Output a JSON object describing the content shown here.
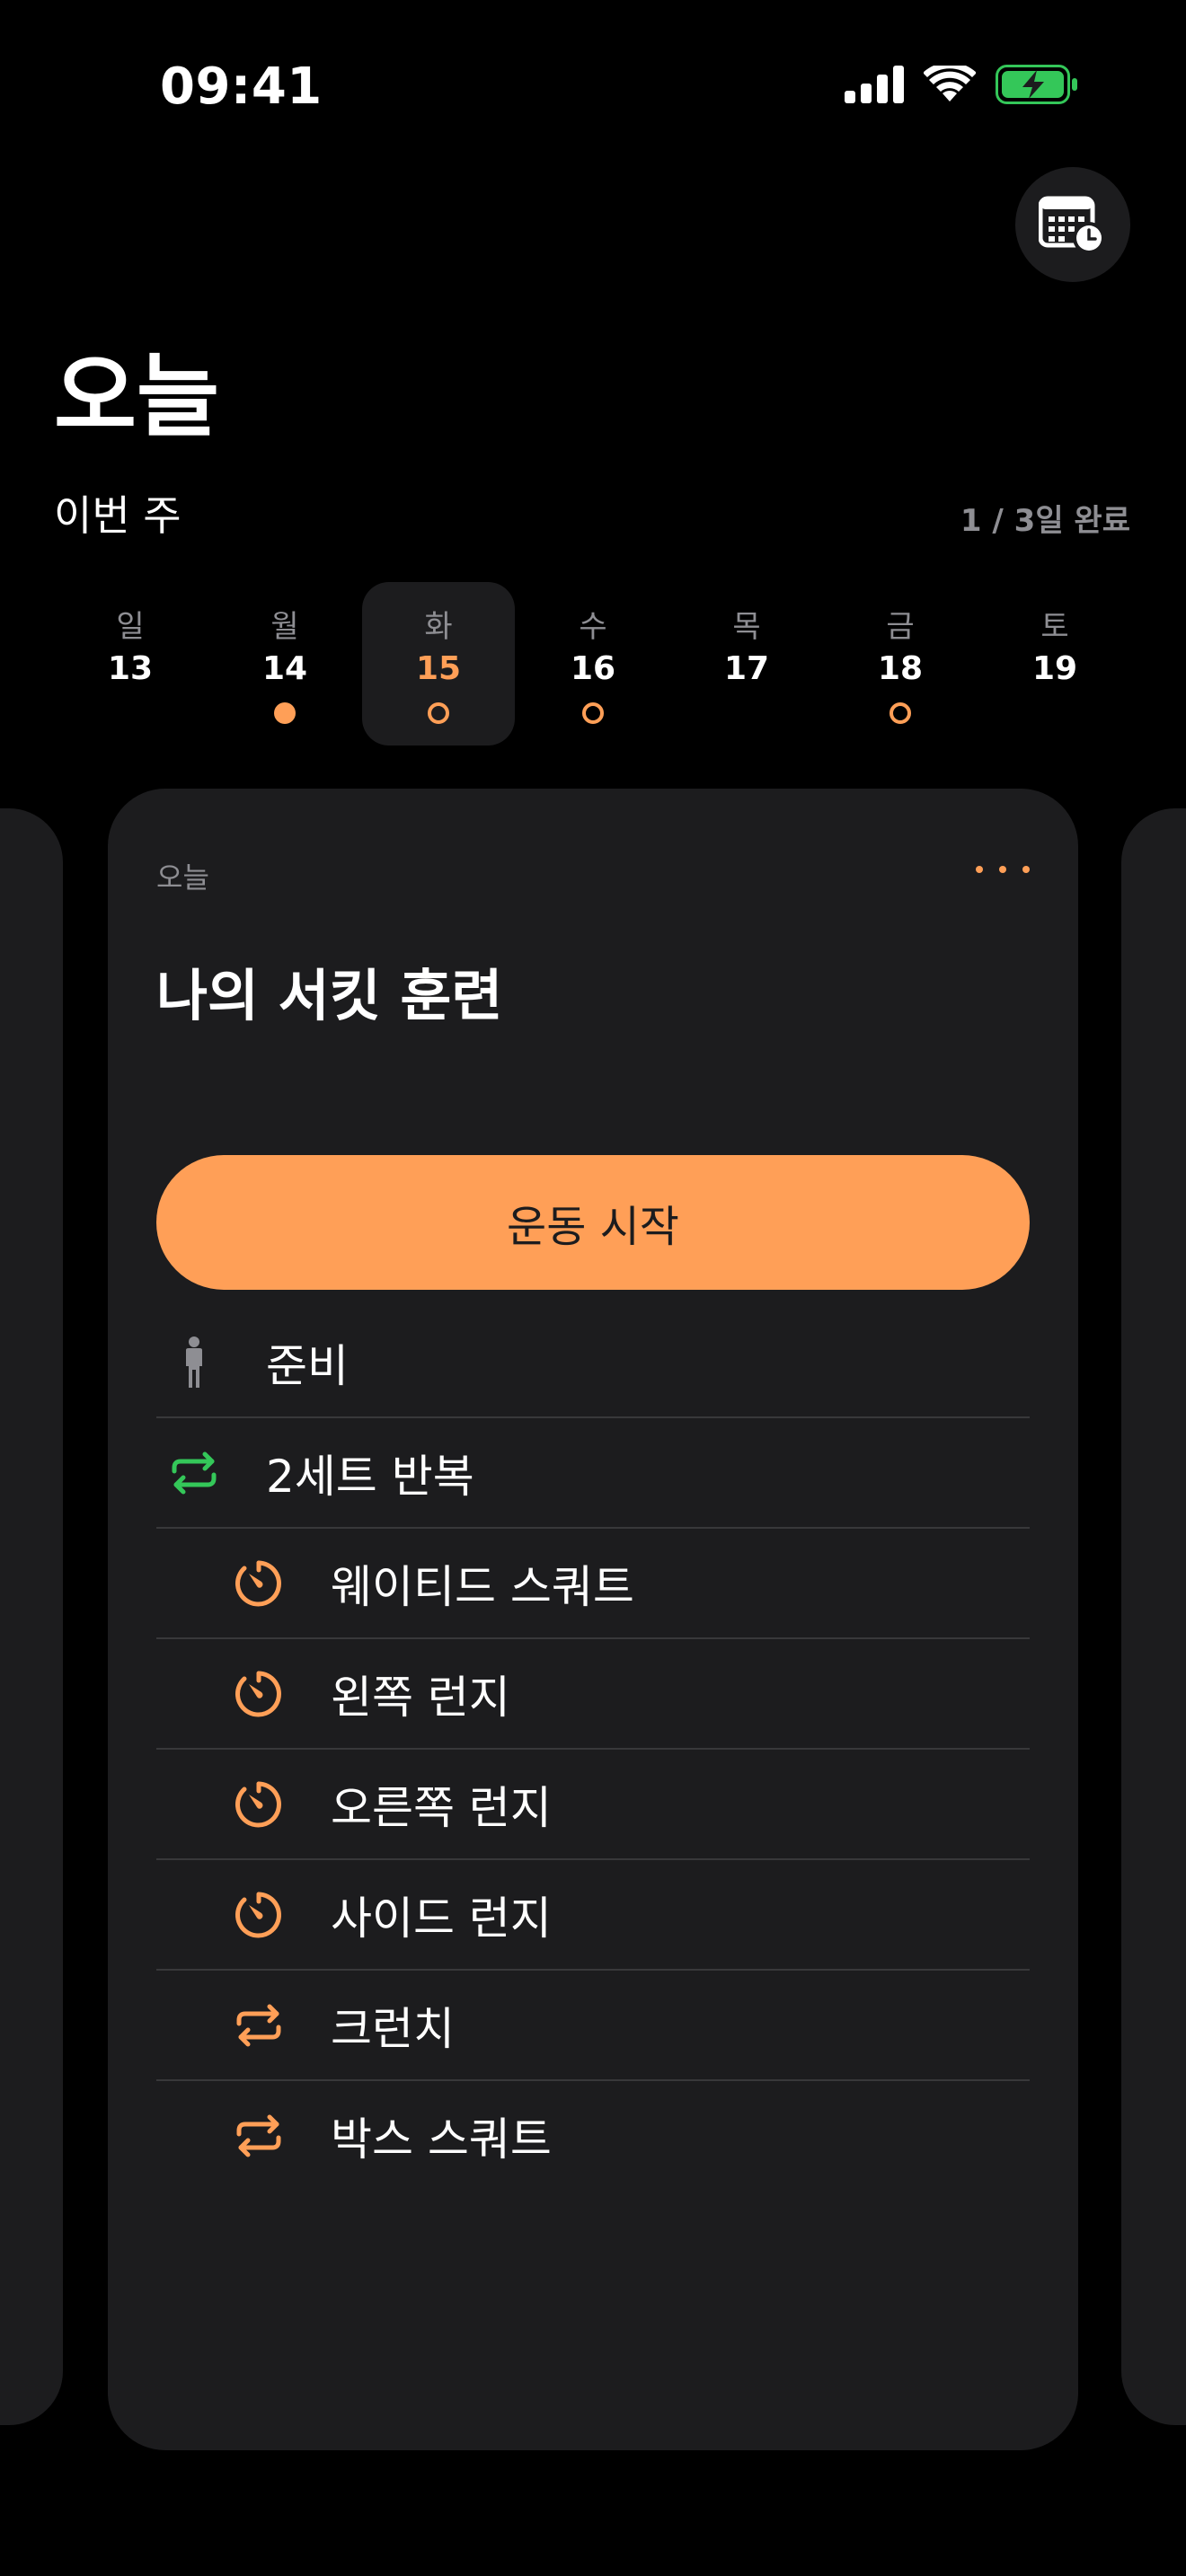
{
  "status_bar": {
    "time": "09:41",
    "icons": [
      "cellular-signal-icon",
      "wifi-icon",
      "battery-charging-icon"
    ],
    "battery_color": "#34c759"
  },
  "header": {
    "calendar_button_icon": "calendar-clock-icon",
    "title": "오늘",
    "week_label": "이번 주",
    "week_progress": "1 / 3일 완료"
  },
  "week": {
    "days": [
      {
        "name": "일",
        "num": "13",
        "marker": "none"
      },
      {
        "name": "월",
        "num": "14",
        "marker": "filled"
      },
      {
        "name": "화",
        "num": "15",
        "marker": "ring",
        "selected": true
      },
      {
        "name": "수",
        "num": "16",
        "marker": "ring"
      },
      {
        "name": "목",
        "num": "17",
        "marker": "none"
      },
      {
        "name": "금",
        "num": "18",
        "marker": "ring"
      },
      {
        "name": "토",
        "num": "19",
        "marker": "none"
      }
    ]
  },
  "card": {
    "subtitle": "오늘",
    "more_icon": "ellipsis-icon",
    "title": "나의 서킷 훈련",
    "start_button": "운동 시작",
    "steps": [
      {
        "label": "준비",
        "icon": "person-standing-icon",
        "level": 0,
        "color": "#8e8e93"
      },
      {
        "label": "2세트 반복",
        "icon": "repeat-icon",
        "level": 0,
        "color": "#34c759"
      },
      {
        "label": "웨이티드 스쿼트",
        "icon": "timer-icon",
        "level": 1,
        "color": "#ff9f57"
      },
      {
        "label": "왼쪽 런지",
        "icon": "timer-icon",
        "level": 1,
        "color": "#ff9f57"
      },
      {
        "label": "오른쪽 런지",
        "icon": "timer-icon",
        "level": 1,
        "color": "#ff9f57"
      },
      {
        "label": "사이드 런지",
        "icon": "timer-icon",
        "level": 1,
        "color": "#ff9f57"
      },
      {
        "label": "크런치",
        "icon": "repeat-icon",
        "level": 1,
        "color": "#ff9f57"
      },
      {
        "label": "박스 스쿼트",
        "icon": "repeat-icon",
        "level": 1,
        "color": "#ff9f57"
      }
    ]
  },
  "colors": {
    "accent": "#ff9f57",
    "background": "#000000",
    "card": "#1c1c1e",
    "secondary_text": "#8e8e93"
  }
}
